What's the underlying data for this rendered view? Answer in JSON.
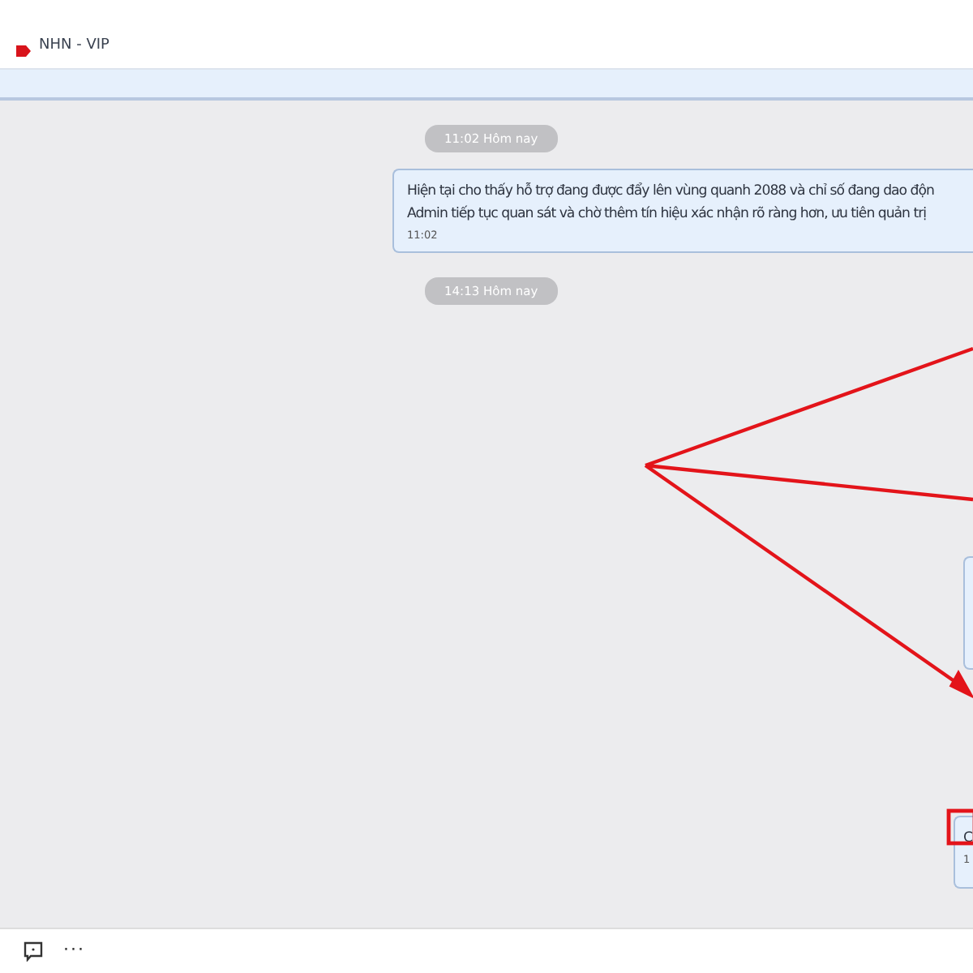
{
  "header": {
    "title": "NHN - VIP"
  },
  "messages": [
    {
      "kind": "time",
      "text": "11:02 Hôm nay"
    },
    {
      "kind": "bubble",
      "lines": [
        "Hiện tại cho thấy hỗ trợ đang được đẩy lên vùng quanh 2088 và chỉ số đang dao độn",
        "Admin tiếp tục quan sát và chờ thêm tín hiệu xác nhận rõ ràng hơn, ưu tiên quản trị"
      ],
      "time": "11:02"
    },
    {
      "kind": "time",
      "text": "14:13 Hôm nay"
    },
    {
      "kind": "edge"
    },
    {
      "kind": "edge",
      "lines": [
        "C"
      ],
      "time": "1"
    }
  ],
  "toolbar": {
    "more": "···"
  }
}
